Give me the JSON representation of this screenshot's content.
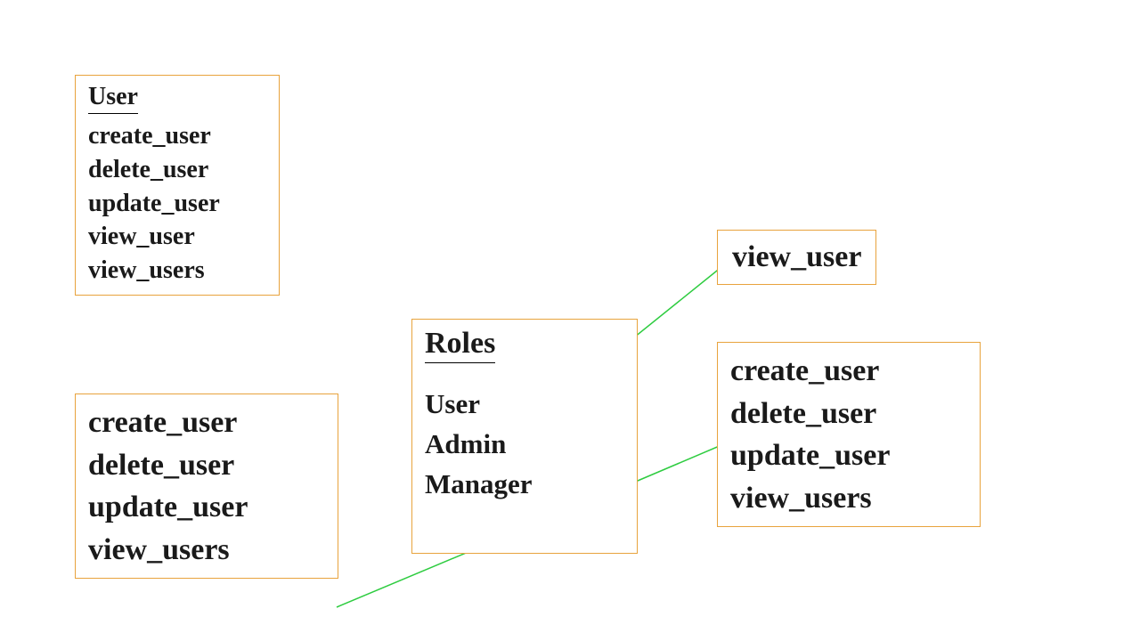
{
  "user_box": {
    "title": "User",
    "items": [
      "create_user",
      "delete_user",
      "update_user",
      "view_user",
      "view_users"
    ]
  },
  "roles_box": {
    "title": "Roles",
    "items": [
      "User",
      "Admin",
      "Manager"
    ]
  },
  "view_user_box": {
    "item": "view_user"
  },
  "admin_perms_box": {
    "items": [
      "create_user",
      "delete_user",
      "update_user",
      "view_users"
    ]
  },
  "manager_perms_box": {
    "items": [
      "create_user",
      "delete_user",
      "update_user",
      "view_users"
    ]
  }
}
